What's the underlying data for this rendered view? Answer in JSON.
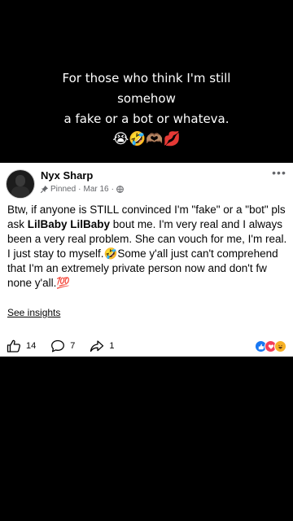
{
  "caption": {
    "line1": "For those who think I'm still",
    "line2": "somehow",
    "line3": "a fake or a bot or whateva.",
    "emoji": "😭🤣🫶🏽💋"
  },
  "post": {
    "author": "Nyx Sharp",
    "pinned_label": "Pinned",
    "separator": "·",
    "date": "Mar 16",
    "more_label": "•••",
    "text_before_mention": "Btw, if anyone is STILL convinced I'm \"fake\" or a \"bot\" pls ask ",
    "mention": "LilBaby LilBaby",
    "text_after_mention": " bout me. I'm very real and I always been a very real problem. She can vouch for me, I'm real. I just stay to myself.🤣Some y'all just can't comprehend that I'm an extremely private person now and don't fw none y'all.💯",
    "see_insights": "See insights"
  },
  "actions": {
    "like_count": "14",
    "comment_count": "7",
    "share_count": "1"
  },
  "colors": {
    "like_blue": "#1877f2",
    "love_red": "#f33e58",
    "haha_yellow": "#f7b125"
  },
  "icons": [
    "pin-icon",
    "globe-icon",
    "more-icon",
    "like-icon",
    "comment-icon",
    "share-icon",
    "like-reaction-icon",
    "love-reaction-icon",
    "haha-reaction-icon"
  ]
}
